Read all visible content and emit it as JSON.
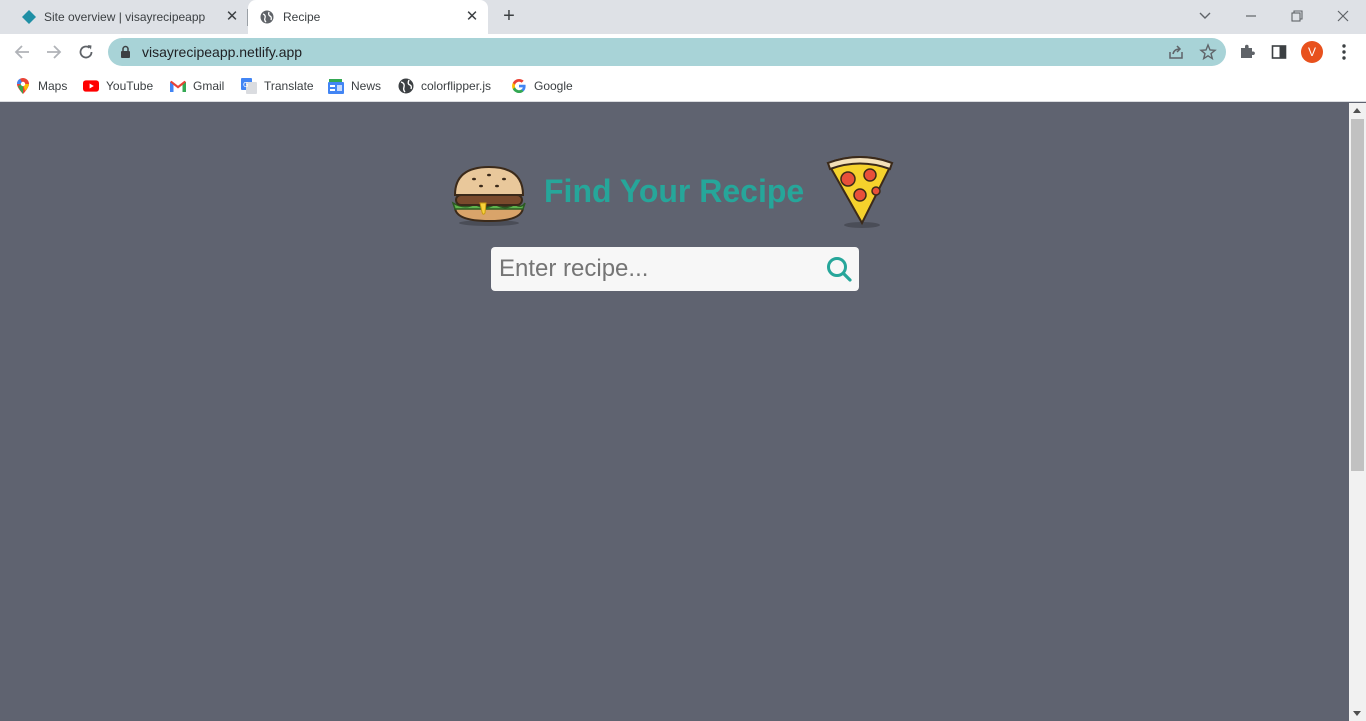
{
  "tabs": [
    {
      "title": "Site overview | visayrecipeapp",
      "favicon": "netlify-diamond-icon",
      "active": false
    },
    {
      "title": "Recipe",
      "favicon": "globe-icon",
      "active": true
    }
  ],
  "toolbar": {
    "url": "visayrecipeapp.netlify.app",
    "profile_initial": "V"
  },
  "bookmarks": [
    {
      "label": "Maps",
      "icon": "maps-pin-icon"
    },
    {
      "label": "YouTube",
      "icon": "youtube-icon"
    },
    {
      "label": "Gmail",
      "icon": "gmail-icon"
    },
    {
      "label": "Translate",
      "icon": "translate-icon"
    },
    {
      "label": "News",
      "icon": "news-icon"
    },
    {
      "label": "colorflipper.js",
      "icon": "globe-icon"
    },
    {
      "label": "Google",
      "icon": "google-icon"
    }
  ],
  "page": {
    "title": "Find Your Recipe",
    "search_placeholder": "Enter recipe...",
    "accent_color": "#26a69a",
    "background_color": "#5f6370"
  }
}
